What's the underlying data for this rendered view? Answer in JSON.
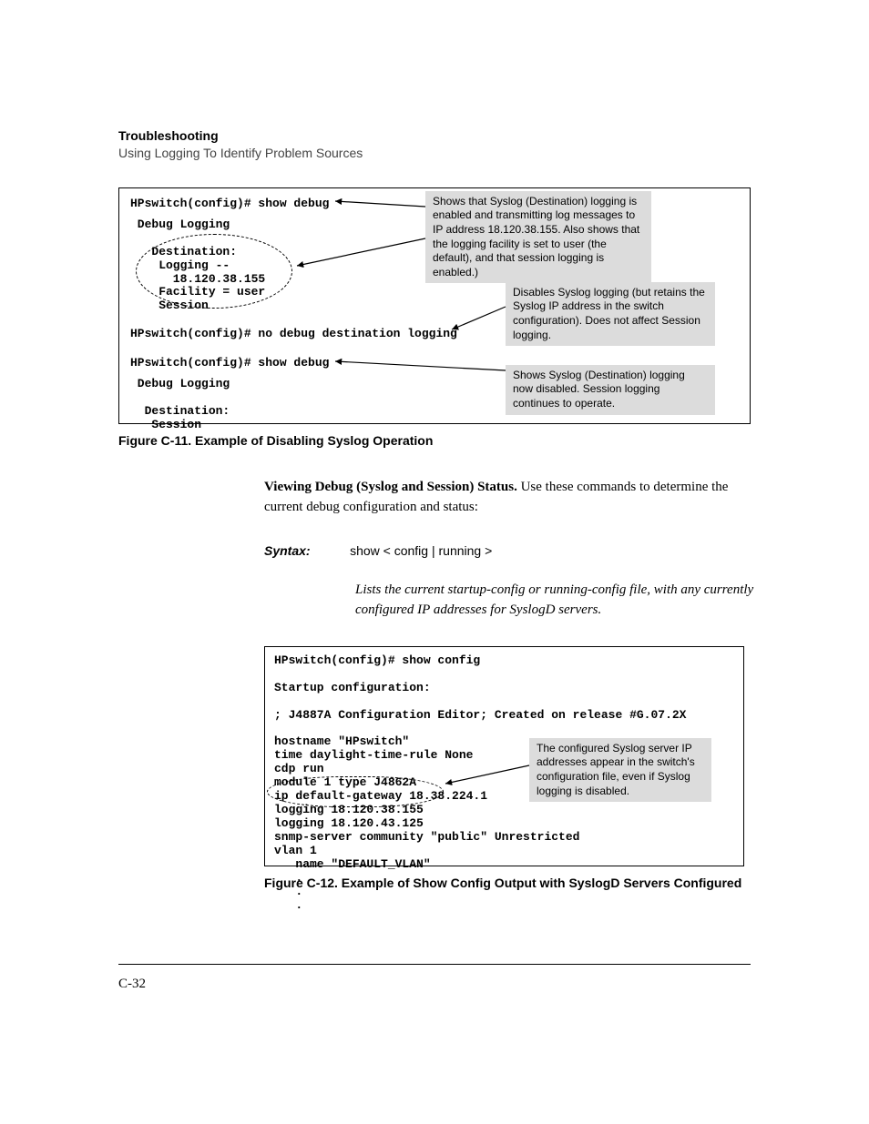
{
  "header": {
    "title": "Troubleshooting",
    "subtitle": "Using Logging To Identify Problem Sources"
  },
  "figure1": {
    "term": {
      "line1": "HPswitch(config)# show debug",
      "block1": " Debug Logging\n\n   Destination:\n    Logging --\n      18.120.38.155\n    Facility = user\n    Session",
      "line2": "HPswitch(config)# no debug destination logging",
      "line3": "HPswitch(config)# show debug",
      "block2": " Debug Logging\n\n  Destination:\n   Session"
    },
    "annot": {
      "a1": "Shows that Syslog (Destination) logging is enabled and transmitting log messages to IP address 18.120.38.155. Also shows that the logging facility is set to user (the default), and that session logging is enabled.)",
      "a2": "Disables Syslog logging (but retains the Syslog IP address in the switch configuration). Does not affect Session logging.",
      "a3": "Shows Syslog (Destination) logging now disabled. Session logging continues to operate."
    },
    "caption": "Figure C-11. Example of Disabling Syslog Operation"
  },
  "body": {
    "heading": "Viewing Debug (Syslog and Session) Status.",
    "text": "Use these commands to determine the current debug configuration and status:",
    "syntax_label": "Syntax:",
    "syntax_cmd": "show < config | running >",
    "syntax_desc": "Lists the current startup-config or running-config file, with any currently configured IP addresses for SyslogD servers."
  },
  "figure2": {
    "term": "HPswitch(config)# show config\n\nStartup configuration:\n\n; J4887A Configuration Editor; Created on release #G.07.2X\n\nhostname \"HPswitch\"\ntime daylight-time-rule None\ncdp run\nmodule 1 type J4862A\nip default-gateway 18.38.224.1\nlogging 18.120.38.155\nlogging 18.120.43.125\nsnmp-server community \"public\" Unrestricted\nvlan 1\n   name \"DEFAULT_VLAN\"\n   .\n   .\n   .",
    "annot": "The configured Syslog server IP addresses appear in the switch's configuration file, even if Syslog logging is disabled.",
    "caption": "Figure C-12. Example of Show Config Output with SyslogD Servers Configured"
  },
  "page_number": "C-32"
}
